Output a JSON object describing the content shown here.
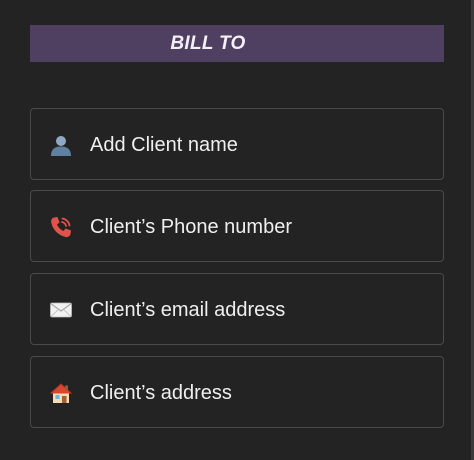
{
  "section": {
    "title": "BILL TO"
  },
  "fields": [
    {
      "icon": "person-icon",
      "placeholder": "Add Client name"
    },
    {
      "icon": "phone-icon",
      "placeholder": "Client’s Phone number"
    },
    {
      "icon": "envelope-icon",
      "placeholder": "Client’s email address"
    },
    {
      "icon": "house-icon",
      "placeholder": "Client’s address"
    }
  ],
  "colors": {
    "background": "#232323",
    "header_bg": "#4f3f61",
    "field_border": "#4a4a4a",
    "text": "#efefef"
  }
}
